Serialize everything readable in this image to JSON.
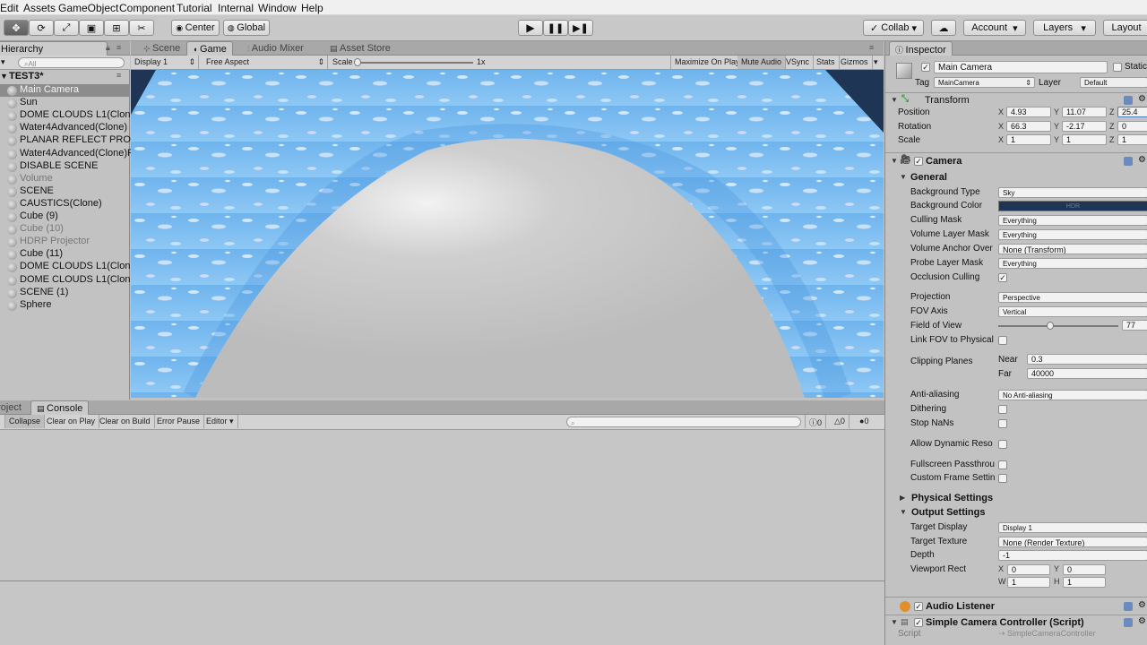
{
  "menu": [
    "Edit",
    "Assets",
    "GameObject",
    "Component",
    "Tutorial",
    "Internal",
    "Window",
    "Help"
  ],
  "toolbar": {
    "pivot": "Center",
    "space": "Global",
    "collab": "Collab",
    "account": "Account",
    "layers": "Layers",
    "layout": "Layout"
  },
  "hierarchy": {
    "tab": "Hierarchy",
    "search_placeholder": "All",
    "scene": "TEST3*",
    "items": [
      {
        "label": "Main Camera",
        "dim": false
      },
      {
        "label": "Sun",
        "dim": false
      },
      {
        "label": "DOME CLOUDS L1(Clone)",
        "dim": false
      },
      {
        "label": "Water4Advanced(Clone)",
        "dim": false
      },
      {
        "label": "PLANAR REFLECT PROBE",
        "dim": false
      },
      {
        "label": "Water4Advanced(Clone)F",
        "dim": false
      },
      {
        "label": "DISABLE SCENE",
        "dim": false
      },
      {
        "label": "Volume",
        "dim": true
      },
      {
        "label": "SCENE",
        "dim": false
      },
      {
        "label": "CAUSTICS(Clone)",
        "dim": false
      },
      {
        "label": "Cube (9)",
        "dim": false
      },
      {
        "label": "Cube (10)",
        "dim": true
      },
      {
        "label": "HDRP Projector",
        "dim": true
      },
      {
        "label": "Cube (11)",
        "dim": false
      },
      {
        "label": "DOME CLOUDS L1(Clone)",
        "dim": false
      },
      {
        "label": "DOME CLOUDS L1(Clone)",
        "dim": false
      },
      {
        "label": "SCENE (1)",
        "dim": false
      },
      {
        "label": "Sphere",
        "dim": false
      }
    ]
  },
  "views": {
    "tabs": [
      "Scene",
      "Game",
      "Audio Mixer",
      "Asset Store"
    ],
    "display": "Display 1",
    "aspect": "Free Aspect",
    "scale_label": "Scale",
    "scale_value": "1x",
    "buttons": [
      "Maximize On Play",
      "Mute Audio",
      "VSync",
      "Stats",
      "Gizmos"
    ]
  },
  "console": {
    "tabs": [
      "Project",
      "Console"
    ],
    "buttons": [
      "Collapse",
      "Clear on Play",
      "Clear on Build",
      "Error Pause",
      "Editor"
    ],
    "counts": [
      "0",
      "0",
      "0"
    ]
  },
  "inspector": {
    "tab": "Inspector",
    "object_name": "Main Camera",
    "static_label": "Static",
    "tag_label": "Tag",
    "tag": "MainCamera",
    "layer_label": "Layer",
    "layer": "Default",
    "transform": {
      "title": "Transform",
      "position_label": "Position",
      "position": [
        "4.93",
        "11.07",
        "25.4"
      ],
      "rotation_label": "Rotation",
      "rotation": [
        "66.3",
        "-2.17",
        "0"
      ],
      "scale_label": "Scale",
      "scale": [
        "1",
        "1",
        "1"
      ]
    },
    "camera": {
      "title": "Camera",
      "general": "General",
      "bg_type_label": "Background Type",
      "bg_type": "Sky",
      "bg_color_label": "Background Color",
      "bg_color_tag": "HDR",
      "culling_label": "Culling Mask",
      "culling": "Everything",
      "vol_layer_label": "Volume Layer Mask",
      "vol_layer": "Everything",
      "vol_anchor_label": "Volume Anchor Over",
      "vol_anchor": "None (Transform)",
      "probe_label": "Probe Layer Mask",
      "probe": "Everything",
      "occlusion_label": "Occlusion Culling",
      "projection_label": "Projection",
      "projection": "Perspective",
      "fov_axis_label": "FOV Axis",
      "fov_axis": "Vertical",
      "fov_label": "Field of View",
      "fov": "77",
      "link_fov_label": "Link FOV to Physical",
      "clipping_label": "Clipping Planes",
      "near_label": "Near",
      "near": "0.3",
      "far_label": "Far",
      "far": "40000",
      "aa_label": "Anti-aliasing",
      "aa": "No Anti-aliasing",
      "dithering_label": "Dithering",
      "stopnans_label": "Stop NaNs",
      "dynres_label": "Allow Dynamic Reso",
      "fullscreen_label": "Fullscreen Passthrou",
      "customframe_label": "Custom Frame Settin",
      "physical": "Physical Settings",
      "output": "Output Settings",
      "target_display_label": "Target Display",
      "target_display": "Display 1",
      "target_texture_label": "Target Texture",
      "target_texture": "None (Render Texture)",
      "depth_label": "Depth",
      "depth": "-1",
      "viewport_label": "Viewport Rect",
      "vp_x": "0",
      "vp_y": "0",
      "vp_w": "1",
      "vp_h": "1"
    },
    "audio_listener": "Audio Listener",
    "script_comp": "Simple Camera Controller (Script)",
    "script_label": "Script",
    "script_value": "SimpleCameraController"
  },
  "colors": {
    "bg_color": "#1e3556",
    "water_light": "#8ec8f5",
    "water_dark": "#3f86d4",
    "dome": "#c4c4c4"
  }
}
